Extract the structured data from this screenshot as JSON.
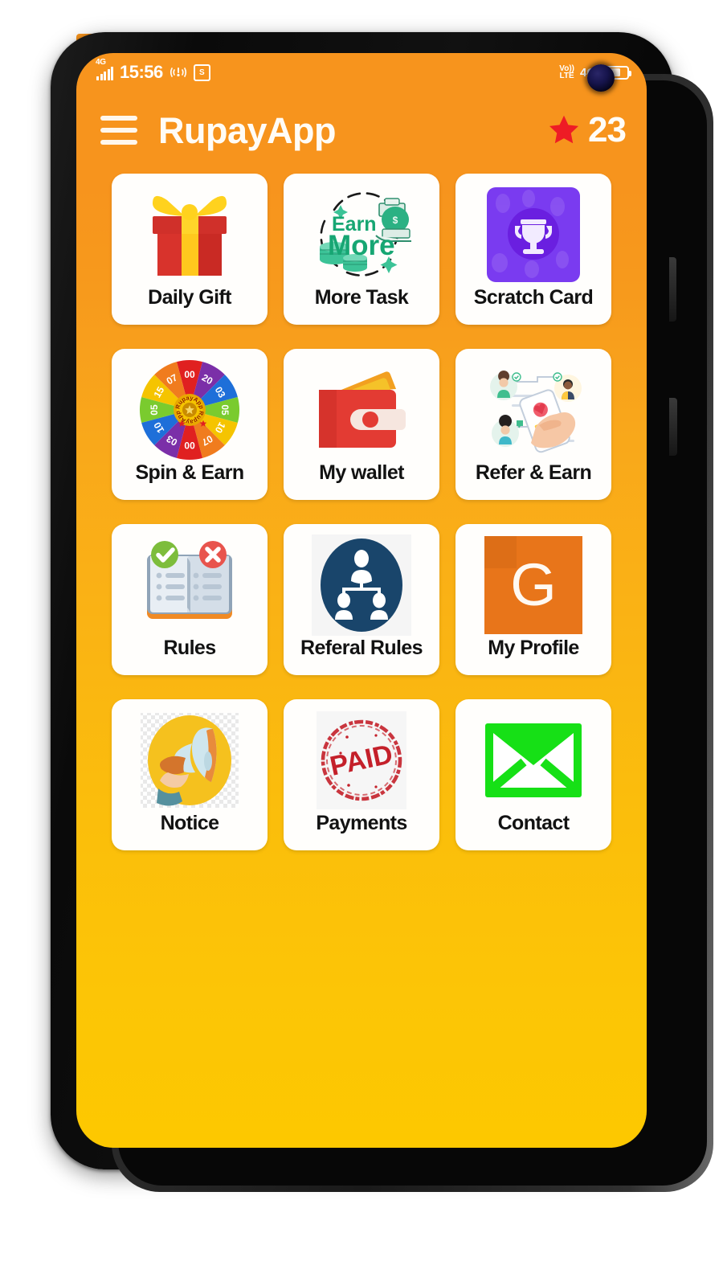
{
  "device": {
    "camera": "punch-hole-camera",
    "buttons": [
      "volume-rocker",
      "power-button"
    ]
  },
  "status_bar": {
    "network_generation": "4G",
    "signal_bars": 5,
    "time": "15:56",
    "hotspot_icon": "hotspot-icon",
    "screenshot_icon": "S",
    "volte_line1": "Vo))",
    "volte_line2": "LTE",
    "network_right": "4G",
    "battery_icon": "battery-icon",
    "battery_level_percent": 72
  },
  "app_bar": {
    "menu_icon": "hamburger-menu-icon",
    "title": "RupayApp",
    "star_icon": "star-icon",
    "points": "23"
  },
  "colors": {
    "header_orange": "#F7941D",
    "background_bottom_yellow": "#FDC800",
    "tile_white": "#FFFEFC",
    "star_red": "#EE1C25",
    "scratch_purple": "#7A3BF0",
    "profile_orange": "#E8751A",
    "contact_green": "#16E016",
    "referal_navy": "#19456B",
    "paid_red": "#C4202A",
    "earn_green": "#17A673",
    "notice_yellow": "#F5C11E"
  },
  "grid": {
    "columns": 3,
    "tiles": [
      {
        "label": "Daily Gift",
        "icon": "gift-box-icon"
      },
      {
        "label": "More Task",
        "icon": "earn-more-icon",
        "icon_text_line1": "Earn",
        "icon_text_line2": "More"
      },
      {
        "label": "Scratch Card",
        "icon": "trophy-card-icon"
      },
      {
        "label": "Spin & Earn",
        "icon": "spin-wheel-icon",
        "wheel_values": [
          "00",
          "20",
          "03",
          "05",
          "10",
          "07",
          "00",
          "03",
          "10",
          "05",
          "15",
          "07"
        ],
        "wheel_center_text": "RupayApp"
      },
      {
        "label": "My wallet",
        "icon": "wallet-icon"
      },
      {
        "label": "Refer & Earn",
        "icon": "refer-friends-icon"
      },
      {
        "label": "Rules",
        "icon": "rulebook-icon"
      },
      {
        "label": "Referal Rules",
        "icon": "people-hierarchy-icon"
      },
      {
        "label": "My Profile",
        "icon": "profile-avatar-icon",
        "avatar_letter": "G"
      },
      {
        "label": "Notice",
        "icon": "megaphone-icon"
      },
      {
        "label": "Payments",
        "icon": "paid-stamp-icon",
        "stamp_text": "PAID"
      },
      {
        "label": "Contact",
        "icon": "envelope-icon"
      }
    ]
  }
}
